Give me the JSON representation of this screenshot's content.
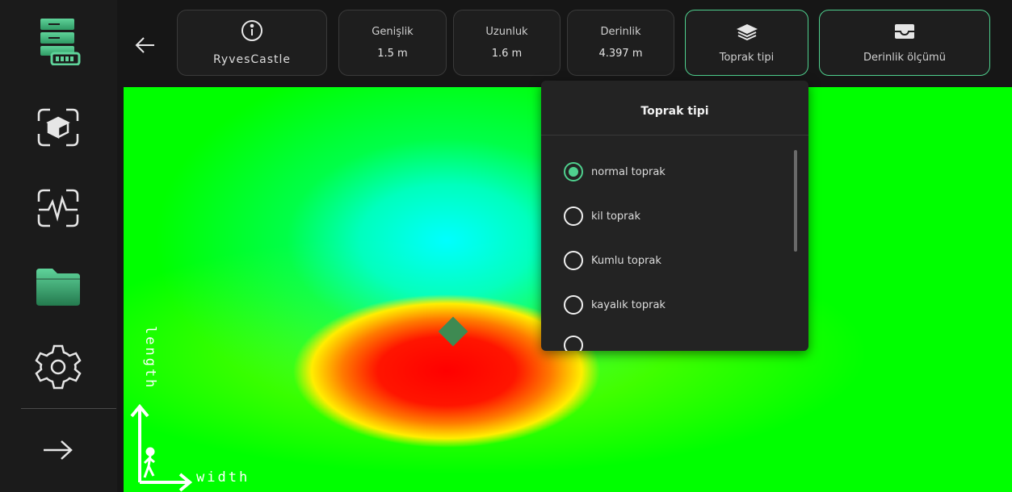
{
  "sidebar": {
    "items": [
      {
        "name": "device-battery-icon"
      },
      {
        "name": "scan-3d-icon"
      },
      {
        "name": "signal-scan-icon"
      },
      {
        "name": "folder-icon"
      },
      {
        "name": "gear-icon"
      },
      {
        "name": "arrow-right-icon"
      }
    ]
  },
  "header": {
    "info_title": "RyvesCastle",
    "stats": [
      {
        "label": "Genişlik",
        "value": "1.5 m"
      },
      {
        "label": "Uzunluk",
        "value": "1.6 m"
      },
      {
        "label": "Derinlik",
        "value": "4.397 m"
      }
    ],
    "soil_button_label": "Toprak tipi",
    "depth_button_label": "Derinlik ölçümü"
  },
  "map": {
    "length_label": "length",
    "width_label": "width"
  },
  "dropdown": {
    "title": "Toprak tipi",
    "options": [
      {
        "label": "normal toprak",
        "selected": true
      },
      {
        "label": "kil toprak",
        "selected": false
      },
      {
        "label": "Kumlu toprak",
        "selected": false
      },
      {
        "label": "kayalık toprak",
        "selected": false
      }
    ]
  },
  "colors": {
    "accent": "#4fd08e",
    "background": "#161616",
    "card": "#1e1e1e"
  }
}
